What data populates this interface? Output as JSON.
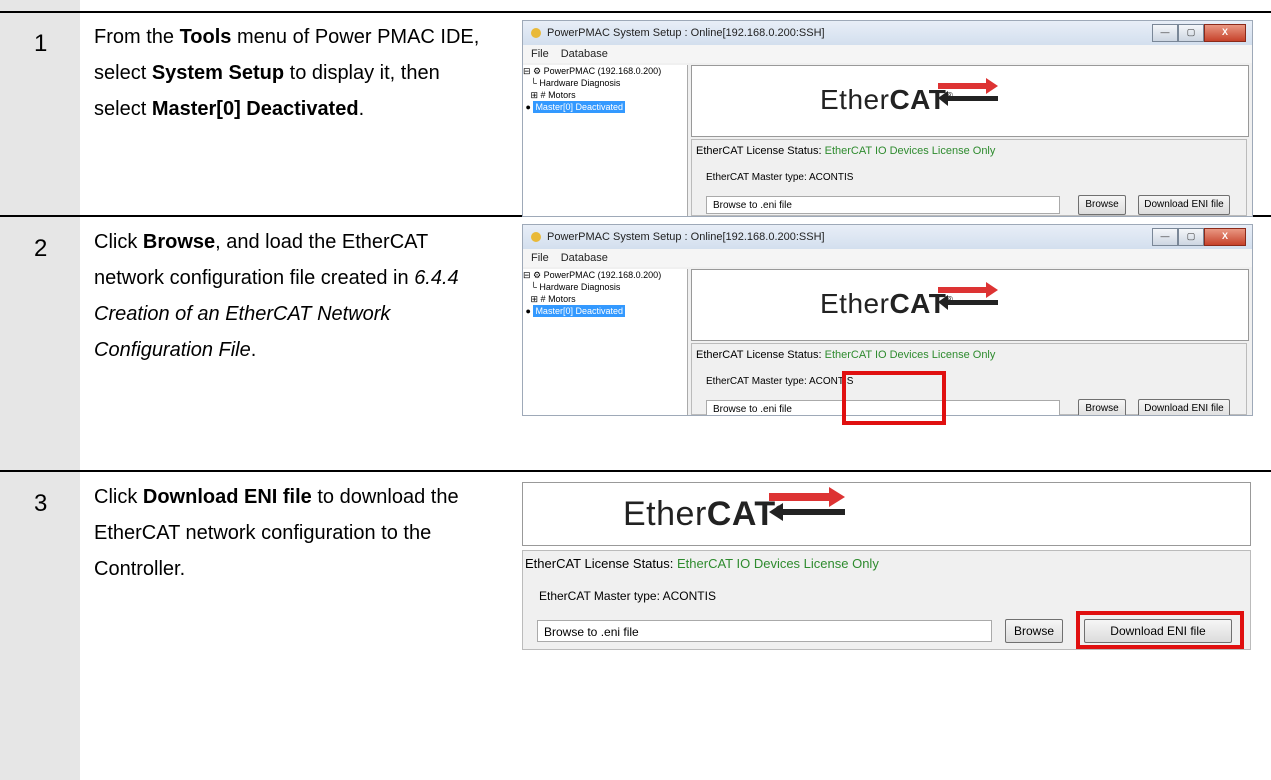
{
  "steps": [
    {
      "num": "1"
    },
    {
      "num": "2"
    },
    {
      "num": "3"
    }
  ],
  "step1": {
    "t1": "From the ",
    "b1": "Tools",
    "t2": " menu of Power PMAC IDE, select ",
    "b2": "System Setup",
    "t3": " to display it, then select ",
    "b3": "Master[0] Deactivated",
    "t4": "."
  },
  "step2": {
    "t1": "Click ",
    "b1": "Browse",
    "t2": ", and load the EtherCAT network configuration file created in ",
    "i1": "6.4.4 Creation of an EtherCAT Network Configuration File",
    "t3": "."
  },
  "step3": {
    "t1": "Click ",
    "b1": "Download ENI file",
    "t2": " to download the EtherCAT network configuration to the Controller."
  },
  "window": {
    "title": "PowerPMAC System Setup  : Online[192.168.0.200:SSH]",
    "menu_file": "File",
    "menu_database": "Database",
    "ctrl_min": "—",
    "ctrl_max": "▢",
    "ctrl_close": "X"
  },
  "tree": {
    "root": "PowerPMAC (192.168.0.200)",
    "hw": "Hardware Diagnosis",
    "motors": "Motors",
    "master": "Master[0] Deactivated"
  },
  "ethercat": {
    "logo_a": "Ether",
    "logo_b": "CAT",
    "logo_reg": "®",
    "license_label": "EtherCAT License Status:",
    "license_value": "EtherCAT IO Devices License Only",
    "master_type": "EtherCAT Master type:  ACONTIS",
    "browse_placeholder": "Browse to .eni file",
    "browse_button": "Browse",
    "download_button": "Download ENI file"
  },
  "colors": {
    "highlight": "#e01010",
    "license_green": "#2e8b2e",
    "step_column": "#e6e6e6"
  }
}
